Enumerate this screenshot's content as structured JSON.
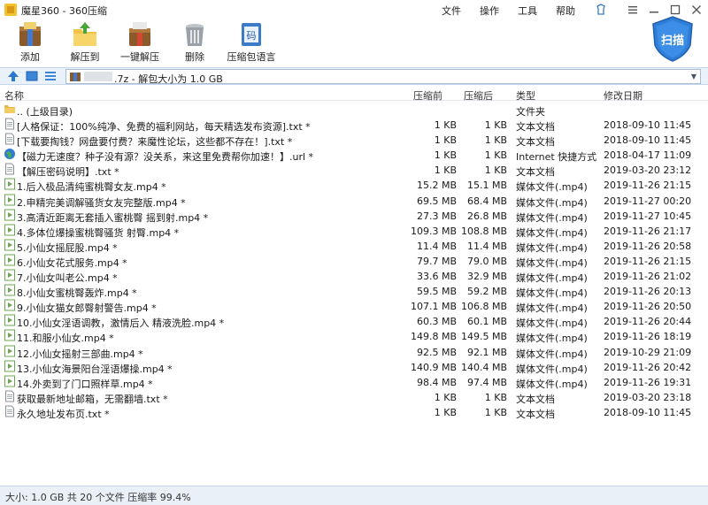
{
  "app": {
    "title": "魔星360 - 360压缩"
  },
  "menu": {
    "file": "文件",
    "operate": "操作",
    "tools": "工具",
    "help": "帮助"
  },
  "toolbar": {
    "add": "添加",
    "extract_to": "解压到",
    "one_click_extract": "一键解压",
    "delete": "删除",
    "zip_language": "压缩包语言",
    "scan": "扫描"
  },
  "address": {
    "text": ".7z - 解包大小为 1.0 GB"
  },
  "columns": {
    "name": "名称",
    "compressed": "压缩前",
    "original": "压缩后",
    "type": "类型",
    "modified": "修改日期"
  },
  "rows": [
    {
      "icon": "folder-up-icon",
      "name": ".. (上级目录)",
      "compressed": "",
      "original": "",
      "type": "文件夹",
      "date": ""
    },
    {
      "icon": "text-file-icon",
      "name": "[人格保证：100%纯净、免费的福利网站，每天精选发布资源].txt *",
      "compressed": "1 KB",
      "original": "1 KB",
      "type": "文本文档",
      "date": "2018-09-10 11:45"
    },
    {
      "icon": "text-file-icon",
      "name": "[下载要掏钱？网盘要付费？来魔性论坛，这些都不存在！].txt *",
      "compressed": "1 KB",
      "original": "1 KB",
      "type": "文本文档",
      "date": "2018-09-10 11:45"
    },
    {
      "icon": "internet-shortcut-icon",
      "name": "【磁力无速度？种子没有源？没关系，来这里免费帮你加速！】.url *",
      "compressed": "1 KB",
      "original": "1 KB",
      "type": "Internet 快捷方式",
      "date": "2018-04-17 11:09"
    },
    {
      "icon": "text-file-icon",
      "name": "【解压密码说明】.txt *",
      "compressed": "1 KB",
      "original": "1 KB",
      "type": "文本文档",
      "date": "2019-03-20 23:12"
    },
    {
      "icon": "video-file-icon",
      "name": "1.后入极品清纯蜜桃臀女友.mp4 *",
      "compressed": "15.2 MB",
      "original": "15.1 MB",
      "type": "媒体文件(.mp4)",
      "date": "2019-11-26 21:15"
    },
    {
      "icon": "video-file-icon",
      "name": "2.申精完美调解骚货女友完整版.mp4 *",
      "compressed": "69.5 MB",
      "original": "68.4 MB",
      "type": "媒体文件(.mp4)",
      "date": "2019-11-27 00:20"
    },
    {
      "icon": "video-file-icon",
      "name": "3.高清近距离无套插入蜜桃臀 摇到射.mp4 *",
      "compressed": "27.3 MB",
      "original": "26.8 MB",
      "type": "媒体文件(.mp4)",
      "date": "2019-11-27 10:45"
    },
    {
      "icon": "video-file-icon",
      "name": "4.多体位爆操蜜桃臀骚货 射臀.mp4 *",
      "compressed": "109.3 MB",
      "original": "108.8 MB",
      "type": "媒体文件(.mp4)",
      "date": "2019-11-26 21:17"
    },
    {
      "icon": "video-file-icon",
      "name": "5.小仙女摇屁股.mp4 *",
      "compressed": "11.4 MB",
      "original": "11.4 MB",
      "type": "媒体文件(.mp4)",
      "date": "2019-11-26 20:58"
    },
    {
      "icon": "video-file-icon",
      "name": "6.小仙女花式服务.mp4 *",
      "compressed": "79.7 MB",
      "original": "79.0 MB",
      "type": "媒体文件(.mp4)",
      "date": "2019-11-26 21:15"
    },
    {
      "icon": "video-file-icon",
      "name": "7.小仙女叫老公.mp4 *",
      "compressed": "33.6 MB",
      "original": "32.9 MB",
      "type": "媒体文件(.mp4)",
      "date": "2019-11-26 21:02"
    },
    {
      "icon": "video-file-icon",
      "name": "8.小仙女蜜桃臀轰炸.mp4 *",
      "compressed": "59.5 MB",
      "original": "59.2 MB",
      "type": "媒体文件(.mp4)",
      "date": "2019-11-26 20:13"
    },
    {
      "icon": "video-file-icon",
      "name": "9.小仙女猫女郎臀射警告.mp4 *",
      "compressed": "107.1 MB",
      "original": "106.8 MB",
      "type": "媒体文件(.mp4)",
      "date": "2019-11-26 20:50"
    },
    {
      "icon": "video-file-icon",
      "name": "10.小仙女淫语调教，激情后入 精液洗脸.mp4 *",
      "compressed": "60.3 MB",
      "original": "60.1 MB",
      "type": "媒体文件(.mp4)",
      "date": "2019-11-26 20:44"
    },
    {
      "icon": "video-file-icon",
      "name": "11.和服小仙女.mp4 *",
      "compressed": "149.8 MB",
      "original": "149.5 MB",
      "type": "媒体文件(.mp4)",
      "date": "2019-11-26 18:19"
    },
    {
      "icon": "video-file-icon",
      "name": "12.小仙女摇射三部曲.mp4 *",
      "compressed": "92.5 MB",
      "original": "92.1 MB",
      "type": "媒体文件(.mp4)",
      "date": "2019-10-29 21:09"
    },
    {
      "icon": "video-file-icon",
      "name": "13.小仙女海景阳台淫语爆操.mp4 *",
      "compressed": "140.9 MB",
      "original": "140.4 MB",
      "type": "媒体文件(.mp4)",
      "date": "2019-11-26 20:42"
    },
    {
      "icon": "video-file-icon",
      "name": "14.外卖到了门口照样草.mp4 *",
      "compressed": "98.4 MB",
      "original": "97.4 MB",
      "type": "媒体文件(.mp4)",
      "date": "2019-11-26 19:31"
    },
    {
      "icon": "text-file-icon",
      "name": "获取最新地址邮箱，无需翻墙.txt *",
      "compressed": "1 KB",
      "original": "1 KB",
      "type": "文本文档",
      "date": "2019-03-20 23:18"
    },
    {
      "icon": "text-file-icon",
      "name": "永久地址发布页.txt *",
      "compressed": "1 KB",
      "original": "1 KB",
      "type": "文本文档",
      "date": "2018-09-10 11:45"
    }
  ],
  "status": {
    "text": "大小: 1.0 GB 共 20 个文件 压缩率 99.4%"
  },
  "colors": {
    "accent": "#2b78d0",
    "video_icon": "#6aa84f",
    "folder": "#e8b84a"
  }
}
